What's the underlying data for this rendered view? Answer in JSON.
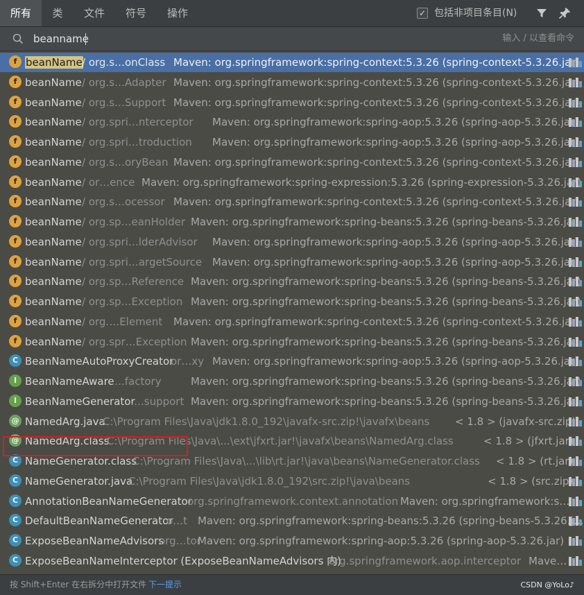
{
  "tabs": [
    {
      "label": "所有",
      "active": true
    },
    {
      "label": "类"
    },
    {
      "label": "文件"
    },
    {
      "label": "符号"
    },
    {
      "label": "操作"
    }
  ],
  "toolbar": {
    "include_non_project_checked": true,
    "include_non_project_label": "包括非项目条目(N)",
    "filter_icon": "filter-icon",
    "pin_icon": "pin-icon"
  },
  "search": {
    "value": "beanname",
    "hint": "输入 / 以查看命令"
  },
  "results": [
    {
      "icon": "f",
      "name": "beanName",
      "highlight": true,
      "path": " / org.s…onClass",
      "lib": "Maven: org.springframework:spring-context:5.3.26 (spring-context-5.3.26.jar)",
      "selected": true
    },
    {
      "icon": "f",
      "name": "beanName",
      "path": " / org.s…Adapter",
      "lib": "Maven: org.springframework:spring-context:5.3.26 (spring-context-5.3.26.jar)"
    },
    {
      "icon": "f",
      "name": "beanName",
      "path": " / org.s…Support",
      "lib": "Maven: org.springframework:spring-context:5.3.26 (spring-context-5.3.26.jar)"
    },
    {
      "icon": "f",
      "name": "beanName",
      "path": " / org.spri…nterceptor",
      "lib": "Maven: org.springframework:spring-aop:5.3.26 (spring-aop-5.3.26.jar)"
    },
    {
      "icon": "f",
      "name": "beanName",
      "path": " / org.spri…troduction",
      "lib": "Maven: org.springframework:spring-aop:5.3.26 (spring-aop-5.3.26.jar)"
    },
    {
      "icon": "f",
      "name": "beanName",
      "path": " / org.s…oryBean",
      "lib": "Maven: org.springframework:spring-context:5.3.26 (spring-context-5.3.26.jar)"
    },
    {
      "icon": "f",
      "name": "beanName",
      "path": " / or…ence",
      "lib": "Maven: org.springframework:spring-expression:5.3.26 (spring-expression-5.3.26.jar)"
    },
    {
      "icon": "f",
      "name": "beanName",
      "path": " / org.s…ocessor",
      "lib": "Maven: org.springframework:spring-context:5.3.26 (spring-context-5.3.26.jar)"
    },
    {
      "icon": "f",
      "name": "beanName",
      "path": " / org.sp…eanHolder",
      "lib": "Maven: org.springframework:spring-beans:5.3.26 (spring-beans-5.3.26.ja…"
    },
    {
      "icon": "f",
      "name": "beanName",
      "path": " / org.spri…lderAdvisor",
      "lib": "Maven: org.springframework:spring-aop:5.3.26 (spring-aop-5.3.26.jar)"
    },
    {
      "icon": "f",
      "name": "beanName",
      "path": " / org.spri…argetSource",
      "lib": "Maven: org.springframework:spring-aop:5.3.26 (spring-aop-5.3.26.jar)"
    },
    {
      "icon": "f",
      "name": "beanName",
      "path": " / org.sp…Reference",
      "lib": "Maven: org.springframework:spring-beans:5.3.26 (spring-beans-5.3.26.jar)"
    },
    {
      "icon": "f",
      "name": "beanName",
      "path": " / org.sp…Exception",
      "lib": "Maven: org.springframework:spring-beans:5.3.26 (spring-beans-5.3.26.jar)"
    },
    {
      "icon": "f",
      "name": "beanName",
      "path": " / org.…Element",
      "lib": "Maven: org.springframework:spring-context:5.3.26 (spring-context-5.3.26.jar)"
    },
    {
      "icon": "f",
      "name": "beanName",
      "path": " / org.spr…Exception",
      "lib": "Maven: org.springframework:spring-beans:5.3.26 (spring-beans-5.3.26.ja…"
    },
    {
      "icon": "c",
      "name": "BeanNameAutoProxyCreator",
      "path": " or…xy",
      "lib": "Maven: org.springframework:spring-aop:5.3.26 (spring-aop-5.3.26.jar)"
    },
    {
      "icon": "i",
      "name": "BeanNameAware",
      "path": " ….factory",
      "lib": "Maven: org.springframework:spring-beans:5.3.26 (spring-beans-5.3.26.jar)"
    },
    {
      "icon": "i",
      "name": "BeanNameGenerator",
      "path": " ….support",
      "lib": "Maven: org.springframework:spring-beans:5.3.26 (spring-beans-5.3.26.ja…"
    },
    {
      "icon": "at",
      "name": "NamedArg.java",
      "path": " C:\\Program Files\\Java\\jdk1.8.0_192\\javafx-src.zip!\\javafx\\beans",
      "lib": "< 1.8 > (javafx-src.zip)"
    },
    {
      "icon": "at",
      "name": "NamedArg.class",
      "path": " C:\\Program Files\\Java\\...\\ext\\jfxrt.jar!\\javafx\\beans\\NamedArg.class",
      "lib": "< 1.8 > (jfxrt.jar)"
    },
    {
      "icon": "c",
      "name": "NameGenerator.class",
      "path": " C:\\Program Files\\Java\\...\\lib\\rt.jar!\\java\\beans\\NameGenerator.class",
      "lib": "< 1.8 > (rt.jar)"
    },
    {
      "icon": "c",
      "name": "NameGenerator.java",
      "path": " C:\\Program Files\\Java\\jdk1.8.0_192\\src.zip!\\java\\beans",
      "lib": "< 1.8 > (src.zip)"
    },
    {
      "icon": "c",
      "name": "AnnotationBeanNameGenerator",
      "path": " org.springframework.context.annotation",
      "lib": "Maven: org.springframework:s…"
    },
    {
      "icon": "c",
      "name": "DefaultBeanNameGenerator",
      "path": " o…t",
      "lib": "Maven: org.springframework:spring-beans:5.3.26 (spring-beans-5.3.26.j…"
    },
    {
      "icon": "c",
      "name": "ExposeBeanNameAdvisors",
      "path": " org…tor",
      "lib": "Maven: org.springframework:spring-aop:5.3.26 (spring-aop-5.3.26.jar)"
    },
    {
      "icon": "c",
      "name": "ExposeBeanNameInterceptor (ExposeBeanNameAdvisors 内)",
      "path": " org.springframework.aop.interceptor",
      "lib": "Mave…"
    }
  ],
  "footer": {
    "hint": "按 Shift+Enter 在右拆分中打开文件",
    "link": "下一提示",
    "watermark": "CSDN @YoLo♪"
  },
  "colors": {
    "selection": "#4a6fa5",
    "highlight": "#d3c482",
    "link": "#589df6",
    "annotation_box": "#d42020"
  }
}
